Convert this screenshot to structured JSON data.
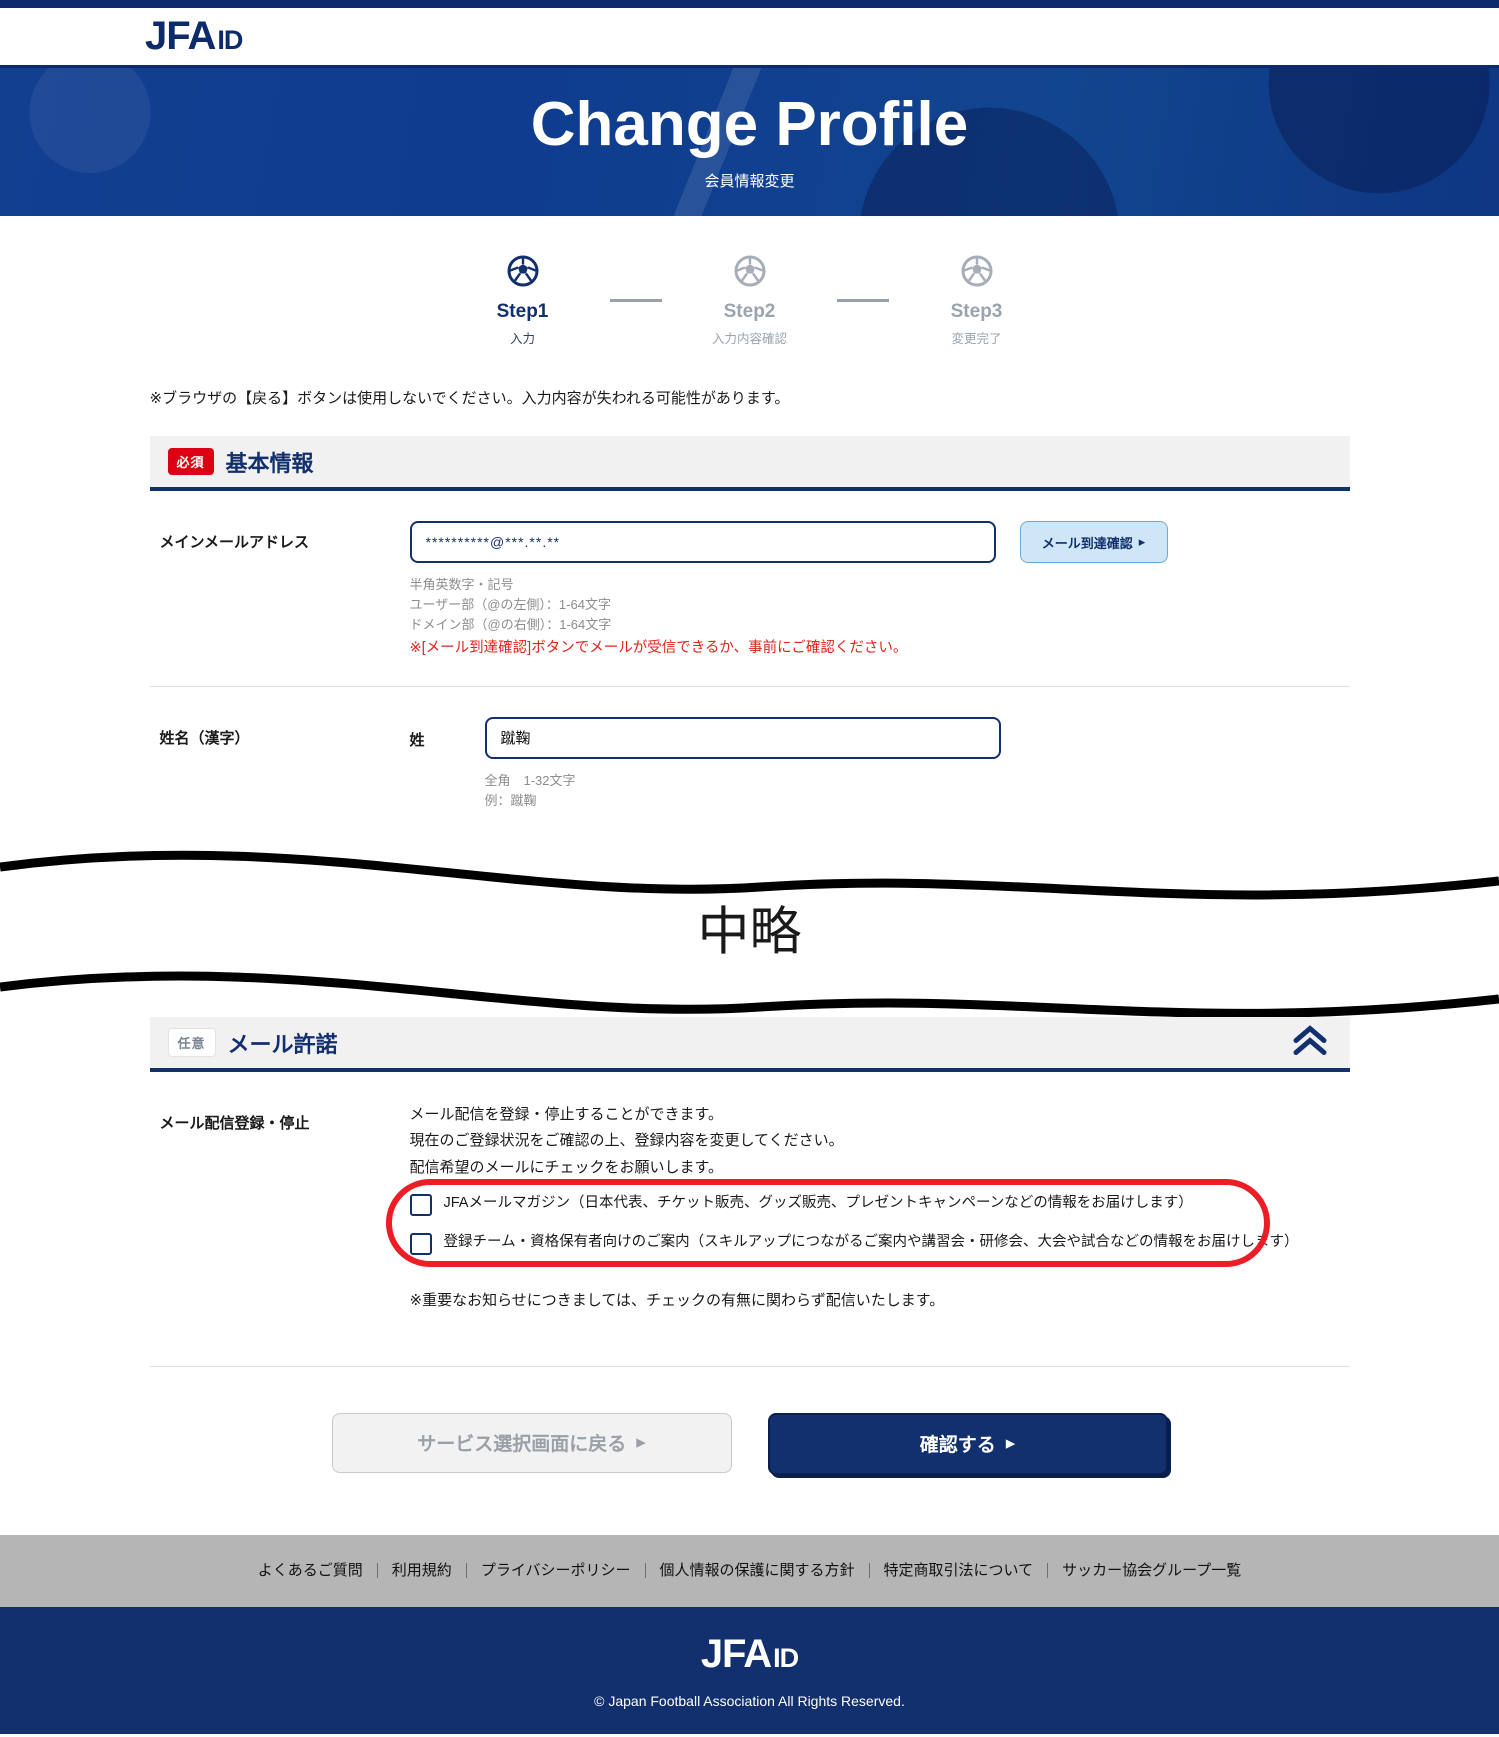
{
  "brand": {
    "jfa": "JFA",
    "id": "ID"
  },
  "hero": {
    "title": "Change Profile",
    "subtitle": "会員情報変更"
  },
  "steps": [
    {
      "label": "Step1",
      "sub": "入力",
      "active": true
    },
    {
      "label": "Step2",
      "sub": "入力内容確認",
      "active": false
    },
    {
      "label": "Step3",
      "sub": "変更完了",
      "active": false
    }
  ],
  "notice": "※ブラウザの【戻る】ボタンは使用しないでください。入力内容が失われる可能性があります。",
  "basic_section": {
    "badge": "必須",
    "title": "基本情報",
    "email_row": {
      "label": "メインメールアドレス",
      "value": "**********@***.**.**",
      "placeholder": "",
      "button_label": "メール到達確認",
      "hints": [
        "半角英数字・記号",
        "ユーザー部（@の左側）：1-64文字",
        "ドメイン部（@の右側）：1-64文字"
      ],
      "warning": "※[メール到達確認]ボタンでメールが受信できるか、事前にご確認ください。"
    },
    "name_row": {
      "label": "姓名（漢字）",
      "sublabel": "姓",
      "value": "蹴鞠",
      "placeholder": "",
      "hints": [
        "全角　1-32文字",
        "例：蹴鞠"
      ]
    }
  },
  "omission": {
    "text": "中略"
  },
  "mail_section": {
    "badge": "任意",
    "title": "メール許諾",
    "collapse_icon": "chevron-up-double-icon",
    "row_label": "メール配信登録・停止",
    "intro": [
      "メール配信を登録・停止することができます。",
      "現在のご登録状況をご確認の上、登録内容を変更してください。",
      "配信希望のメールにチェックをお願いします。"
    ],
    "checkboxes": [
      {
        "label": "JFAメールマガジン（日本代表、チケット販売、グッズ販売、プレゼントキャンペーンなどの情報をお届けします）",
        "checked": false
      },
      {
        "label": "登録チーム・資格保有者向けのご案内（スキルアップにつながるご案内や講習会・研修会、大会や試合などの情報をお届けします）",
        "checked": false
      }
    ],
    "note": "※重要なお知らせにつきましては、チェックの有無に関わらず配信いたします。",
    "highlight_color": "#ee1c25"
  },
  "actions": {
    "back_label": "サービス選択画面に戻る",
    "confirm_label": "確認する"
  },
  "footer": {
    "links": [
      "よくあるご質問",
      "利用規約",
      "プライバシーポリシー",
      "個人情報の保護に関する方針",
      "特定商取引法について",
      "サッカー協会グループ一覧"
    ],
    "copyright": "© Japan Football Association All Rights Reserved."
  },
  "colors": {
    "navy": "#12306e",
    "hero_blue": "#10439a",
    "required_red": "#dd0012",
    "accent_red": "#e2231a"
  }
}
